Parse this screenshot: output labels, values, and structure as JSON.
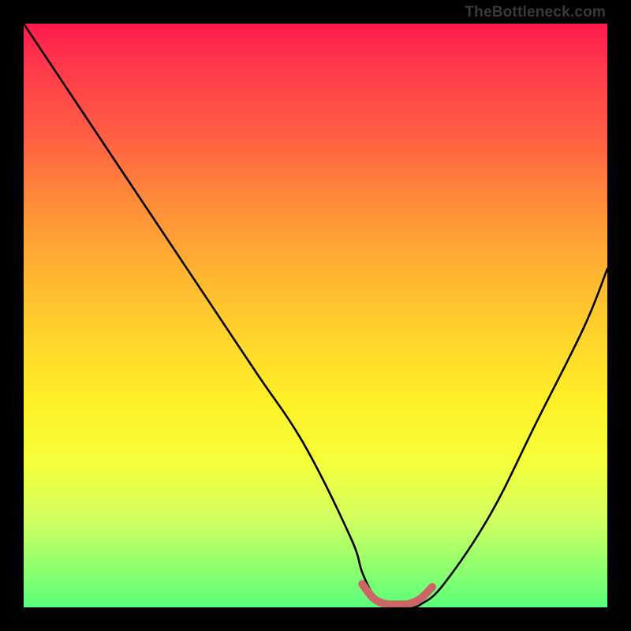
{
  "watermark": "TheBottleneck.com",
  "chart_data": {
    "type": "line",
    "title": "",
    "xlabel": "",
    "ylabel": "",
    "xlim": [
      0,
      100
    ],
    "ylim": [
      0,
      100
    ],
    "series": [
      {
        "name": "bottleneck-curve",
        "color": "#000000",
        "x": [
          0,
          8,
          16,
          24,
          32,
          40,
          48,
          56,
          58,
          60,
          62,
          64,
          66,
          68,
          72,
          80,
          88,
          96,
          100
        ],
        "values": [
          100,
          88,
          76,
          64,
          52,
          40,
          28,
          12,
          6,
          2,
          0.5,
          0,
          0,
          0.5,
          4,
          16,
          32,
          48,
          58
        ]
      },
      {
        "name": "highlight-segment",
        "color": "#cc6666",
        "x": [
          58,
          60,
          62,
          64,
          66,
          68,
          70
        ],
        "values": [
          4,
          1.5,
          0.6,
          0.5,
          0.6,
          1.5,
          3.5
        ]
      }
    ],
    "gradient_stops": [
      {
        "pos": 0,
        "color": "#ff1a4d"
      },
      {
        "pos": 8,
        "color": "#ff3b4a"
      },
      {
        "pos": 18,
        "color": "#ff5a44"
      },
      {
        "pos": 30,
        "color": "#ff8a3a"
      },
      {
        "pos": 42,
        "color": "#ffb232"
      },
      {
        "pos": 55,
        "color": "#ffd82a"
      },
      {
        "pos": 65,
        "color": "#fff028"
      },
      {
        "pos": 75,
        "color": "#f5ff3a"
      },
      {
        "pos": 85,
        "color": "#d0ff60"
      },
      {
        "pos": 100,
        "color": "#5aff7a"
      }
    ]
  }
}
